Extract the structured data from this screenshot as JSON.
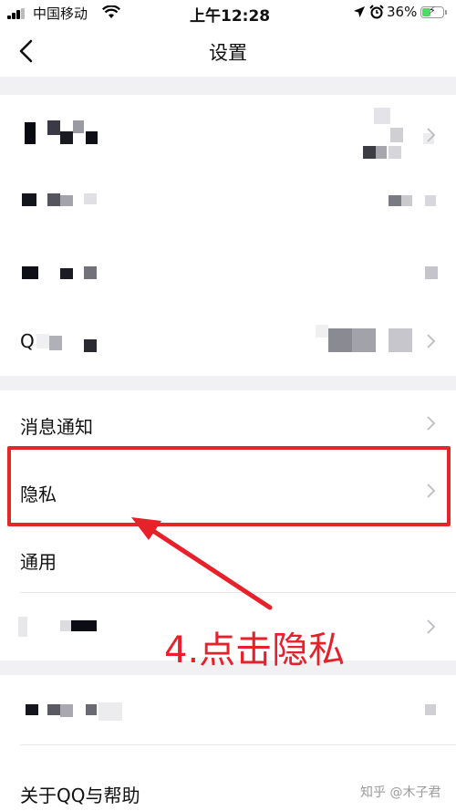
{
  "status_bar": {
    "carrier": "中国移动",
    "time": "上午12:28",
    "battery": "36%",
    "battery_level": 0.36
  },
  "nav": {
    "title": "设置"
  },
  "menu": {
    "notifications_label": "消息通知",
    "privacy_label": "隐私",
    "general_label": "通用",
    "about_label": "关于QQ与帮助",
    "qq_row_prefix": "Q"
  },
  "annotation": {
    "text": "4.点击隐私",
    "color": "#e8202a"
  },
  "watermark": "知乎 @木子君",
  "colors": {
    "accent": "#e4262b",
    "section_gap": "#f1f1f4"
  }
}
